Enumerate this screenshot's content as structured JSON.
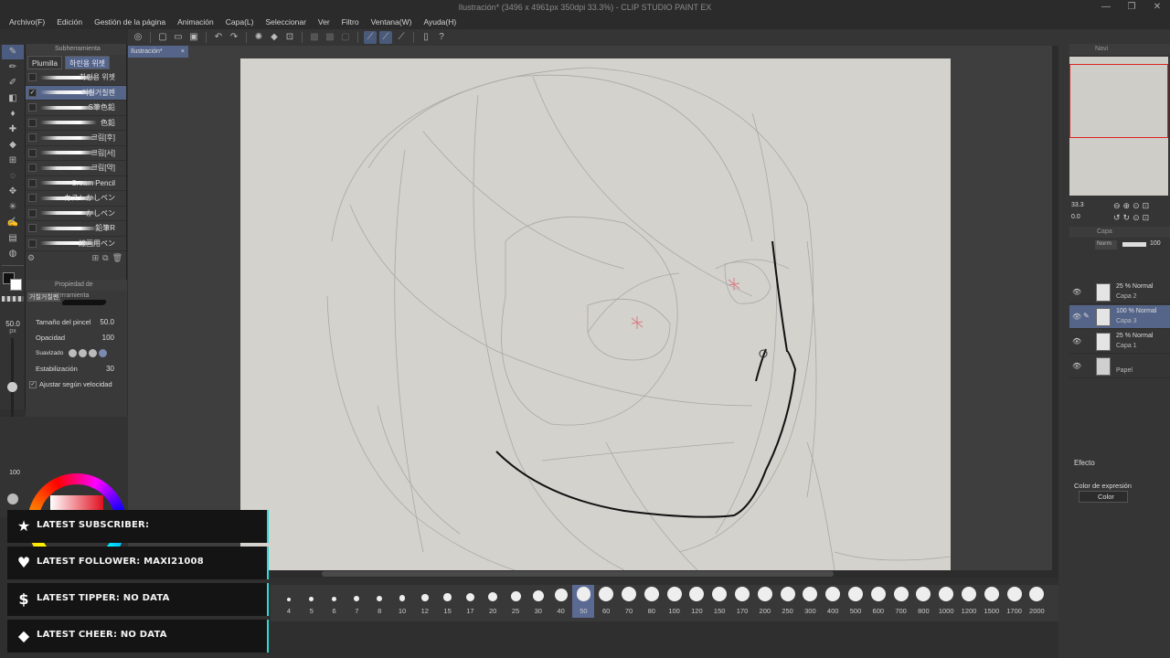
{
  "window": {
    "title": "Ilustración* (3496 x 4961px 350dpi 33.3%) - CLIP STUDIO PAINT EX",
    "minimize": "—",
    "maximize": "❐",
    "close": "✕"
  },
  "menu": [
    "Archivo(F)",
    "Edición",
    "Gestión de la página",
    "Animación",
    "Capa(L)",
    "Seleccionar",
    "Ver",
    "Filtro",
    "Ventana(W)",
    "Ayuda(H)"
  ],
  "subtool": {
    "header": "Subherramienta",
    "tabs": [
      "Plumilla",
      "하린용 위젯"
    ],
    "brushes": [
      {
        "name": "하린용 위젯",
        "checked": false
      },
      {
        "name": "거칠거칠펜",
        "checked": true
      },
      {
        "name": "S筆色鉛",
        "checked": false
      },
      {
        "name": "色鉛",
        "checked": false
      },
      {
        "name": "크림[후]",
        "checked": false
      },
      {
        "name": "크림[서]",
        "checked": false
      },
      {
        "name": "크림[약]",
        "checked": false
      },
      {
        "name": "Cream Pencil",
        "checked": false
      },
      {
        "name": "カスレかしペン",
        "checked": false
      },
      {
        "name": "かしペン",
        "checked": false
      },
      {
        "name": "鉛筆R",
        "checked": false
      },
      {
        "name": "線画用ペン",
        "checked": false
      }
    ]
  },
  "toolprop": {
    "header": "Propiedad de herramienta",
    "brush_label": "거칠거칠펜",
    "size_label": "Tamaño del pincel",
    "size_value": "50.0",
    "opacity_label": "Opacidad",
    "opacity_value": "100",
    "smooth_label": "Suavizado",
    "stab_label": "Estabilización",
    "stab_value": "30",
    "speed_label": "Ajustar según velocidad"
  },
  "left": {
    "brush_size": "50.0",
    "brush_unit": "px",
    "opacity": "100"
  },
  "canvas": {
    "doc_tab": "Ilustración*",
    "tab_close": "×",
    "paper_color": "#d4d2cd"
  },
  "brush_sizes": [
    "4",
    "5",
    "6",
    "7",
    "8",
    "10",
    "12",
    "15",
    "17",
    "20",
    "25",
    "30",
    "40",
    "50",
    "60",
    "70",
    "80",
    "100",
    "120",
    "150",
    "170",
    "200",
    "250",
    "300",
    "400",
    "500",
    "600",
    "700",
    "800",
    "1000",
    "1200",
    "1500",
    "1700",
    "2000"
  ],
  "brush_sizes_selected": "50",
  "navigator": {
    "header": "Navi",
    "zoom": "33.3",
    "angle": "0.0"
  },
  "layers": {
    "header": "Capa",
    "blend": "Norm",
    "opacity": "100",
    "items": [
      {
        "mode": "25 % Normal",
        "name": "Capa 2",
        "selected": false
      },
      {
        "mode": "100 % Normal",
        "name": "Capa 3",
        "selected": true
      },
      {
        "mode": "25 % Normal",
        "name": "Capa 1",
        "selected": false
      },
      {
        "mode": "",
        "name": "Papel",
        "selected": false
      }
    ]
  },
  "effect": {
    "title": "Efecto",
    "expr_label": "Color de expresión",
    "expr_value": "Color"
  },
  "alerts": [
    {
      "icon": "star-icon",
      "glyph": "★",
      "text": "LATEST SUBSCRIBER:"
    },
    {
      "icon": "heart-icon",
      "glyph": "♥",
      "text": "LATEST FOLLOWER: MAXI21008"
    },
    {
      "icon": "dollar-icon",
      "glyph": "$",
      "text": "LATEST TIPPER: NO DATA"
    },
    {
      "icon": "diamond-icon",
      "glyph": "◆",
      "text": "LATEST CHEER: NO DATA"
    }
  ],
  "colors": {
    "alert_accent": "#32d8d8",
    "selection": "#55658a",
    "stroke": "#111111"
  }
}
